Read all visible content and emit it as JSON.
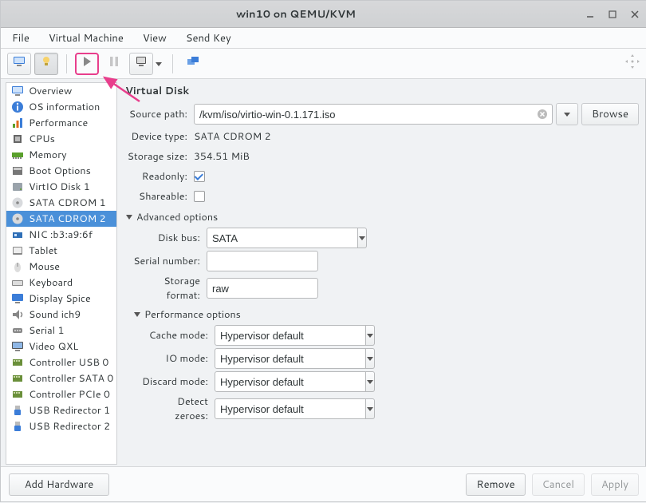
{
  "window": {
    "title": "win10 on QEMU/KVM"
  },
  "menubar": {
    "file": "File",
    "vm": "Virtual Machine",
    "view": "View",
    "sendkey": "Send Key"
  },
  "sidebar": {
    "items": [
      {
        "label": "Overview",
        "icon": "monitor"
      },
      {
        "label": "OS information",
        "icon": "info"
      },
      {
        "label": "Performance",
        "icon": "chart"
      },
      {
        "label": "CPUs",
        "icon": "cpu"
      },
      {
        "label": "Memory",
        "icon": "memory"
      },
      {
        "label": "Boot Options",
        "icon": "boot"
      },
      {
        "label": "VirtIO Disk 1",
        "icon": "disk"
      },
      {
        "label": "SATA CDROM 1",
        "icon": "cdrom"
      },
      {
        "label": "SATA CDROM 2",
        "icon": "cdrom",
        "selected": true
      },
      {
        "label": "NIC :b3:a9:6f",
        "icon": "nic"
      },
      {
        "label": "Tablet",
        "icon": "tablet"
      },
      {
        "label": "Mouse",
        "icon": "mouse"
      },
      {
        "label": "Keyboard",
        "icon": "keyboard"
      },
      {
        "label": "Display Spice",
        "icon": "display"
      },
      {
        "label": "Sound ich9",
        "icon": "sound"
      },
      {
        "label": "Serial 1",
        "icon": "serial"
      },
      {
        "label": "Video QXL",
        "icon": "video"
      },
      {
        "label": "Controller USB 0",
        "icon": "controller"
      },
      {
        "label": "Controller SATA 0",
        "icon": "controller"
      },
      {
        "label": "Controller PCIe 0",
        "icon": "controller"
      },
      {
        "label": "USB Redirector 1",
        "icon": "usb"
      },
      {
        "label": "USB Redirector 2",
        "icon": "usb"
      }
    ]
  },
  "pane": {
    "title": "Virtual Disk",
    "source_path_label": "Source path:",
    "source_path": "/kvm/iso/virtio-win-0.1.171.iso",
    "browse": "Browse",
    "device_type_label": "Device type:",
    "device_type": "SATA CDROM 2",
    "storage_size_label": "Storage size:",
    "storage_size": "354.51 MiB",
    "readonly_label": "Readonly:",
    "readonly": true,
    "shareable_label": "Shareable:",
    "shareable": false,
    "adv_header": "Advanced options",
    "disk_bus_label": "Disk bus:",
    "disk_bus": "SATA",
    "serial_label": "Serial number:",
    "serial": "",
    "storage_format_label": "Storage format:",
    "storage_format": "raw",
    "perf_header": "Performance options",
    "cache_mode_label": "Cache mode:",
    "cache_mode": "Hypervisor default",
    "io_mode_label": "IO mode:",
    "io_mode": "Hypervisor default",
    "discard_mode_label": "Discard mode:",
    "discard_mode": "Hypervisor default",
    "detect_zeroes_label": "Detect zeroes:",
    "detect_zeroes": "Hypervisor default"
  },
  "footer": {
    "add_hardware": "Add Hardware",
    "remove": "Remove",
    "cancel": "Cancel",
    "apply": "Apply"
  }
}
